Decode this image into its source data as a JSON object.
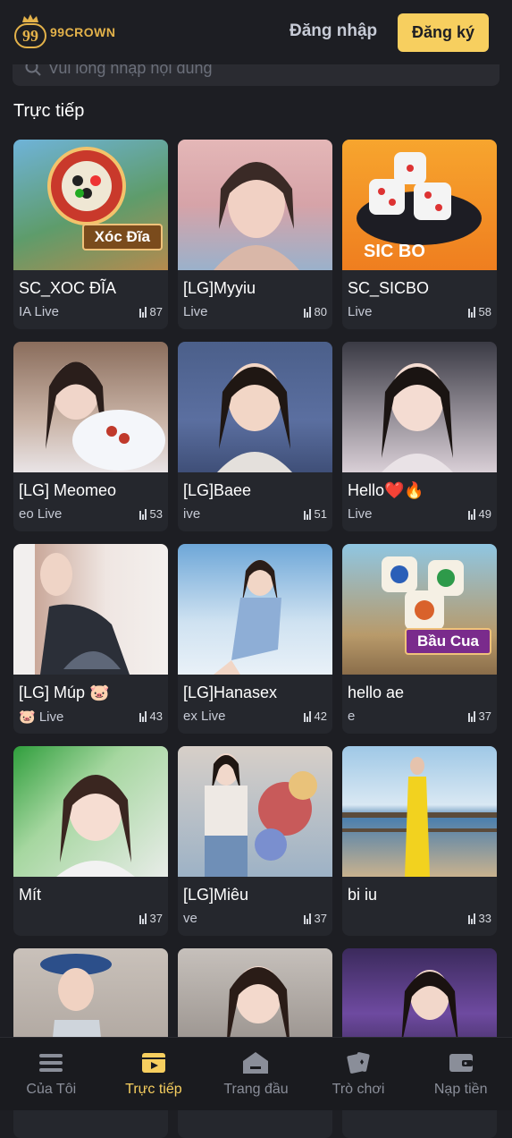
{
  "header": {
    "logo_number": "99",
    "logo_text": "99CROWN",
    "login_label": "Đăng nhập",
    "register_label": "Đăng ký"
  },
  "search": {
    "placeholder": "Vui lòng nhập nội dung"
  },
  "section_title": "Trực tiếp",
  "cards": [
    {
      "title": "SC_XOC ĐĨA",
      "sub": "IA Live",
      "viewers": "87",
      "tag": "Xóc Đĩa"
    },
    {
      "title": "[LG]Myyiu",
      "sub": "Live",
      "viewers": "80"
    },
    {
      "title": "SC_SICBO",
      "sub": "Live",
      "viewers": "58",
      "tag": "SIC BO"
    },
    {
      "title": "[LG] Meomeo",
      "sub": "eo Live",
      "viewers": "53"
    },
    {
      "title": "[LG]Baee",
      "sub": "ive",
      "viewers": "51"
    },
    {
      "title": "Hello❤️🔥",
      "sub": "Live",
      "viewers": "49"
    },
    {
      "title": "[LG] Múp 🐷",
      "sub": "🐷 Live",
      "viewers": "43"
    },
    {
      "title": "[LG]Hanasex",
      "sub": "ex Live",
      "viewers": "42"
    },
    {
      "title": "hello ae",
      "sub": "e",
      "viewers": "37",
      "tag": "Bầu Cua"
    },
    {
      "title": "Mít",
      "sub": "",
      "viewers": "37"
    },
    {
      "title": "[LG]Miêu",
      "sub": "ve",
      "viewers": "37"
    },
    {
      "title": "bi iu",
      "sub": "",
      "viewers": "33"
    },
    {
      "title": "",
      "sub": "",
      "viewers": ""
    },
    {
      "title": "",
      "sub": "",
      "viewers": ""
    },
    {
      "title": "",
      "sub": "",
      "viewers": ""
    }
  ],
  "nav": [
    {
      "label": "Của Tôi",
      "icon": "menu-icon"
    },
    {
      "label": "Trực tiếp",
      "icon": "live-video-icon"
    },
    {
      "label": "Trang đầu",
      "icon": "home-icon"
    },
    {
      "label": "Trò chơi",
      "icon": "cards-icon"
    },
    {
      "label": "Nạp tiền",
      "icon": "wallet-icon"
    }
  ],
  "colors": {
    "accent": "#f7cf5f",
    "background": "#1d1e23",
    "card": "#25272d",
    "logo_gold": "#e3b24a"
  }
}
